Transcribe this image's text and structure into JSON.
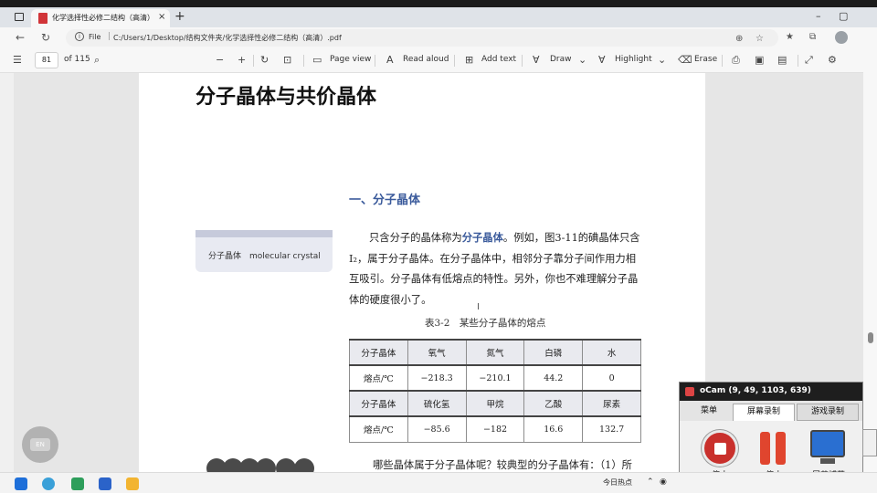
{
  "browser": {
    "tab_title": "化学选择性必修二结构（高清）",
    "tab_close": "×",
    "new_tab": "+",
    "min": "–",
    "restore": "▢",
    "address_prefix": "File",
    "address_sep": "|",
    "url": "C:/Users/1/Desktop/结构文件夹/化学选择性必修二结构（高清）.pdf"
  },
  "pdf_toolbar": {
    "page_current": "81",
    "page_total": "of 115",
    "zoom_out": "−",
    "zoom_in": "+",
    "page_view": "Page view",
    "read_aloud": "Read aloud",
    "add_text": "Add text",
    "draw": "Draw",
    "highlight": "Highlight",
    "erase": "Erase"
  },
  "document": {
    "title": "分子晶体与共价晶体",
    "section_heading": "一、分子晶体",
    "sidenote": "分子晶体　molecular crystal",
    "para_before": "只含分子的晶体称为",
    "para_term": "分子晶体",
    "para_after": "。例如，图3-11的碘晶体只含I₂，属于分子晶体。在分子晶体中，相邻分子靠分子间作用力相互吸引。分子晶体有低熔点的特性。另外，你也不难理解分子晶体的硬度很小了。",
    "table_caption": "表3-2　某些分子晶体的熔点",
    "table_rows": [
      [
        "分子晶体",
        "氧气",
        "氮气",
        "白磷",
        "水"
      ],
      [
        "熔点/℃",
        "−218.3",
        "−210.1",
        "44.2",
        "0"
      ],
      [
        "分子晶体",
        "硫化氢",
        "甲烷",
        "乙酸",
        "尿素"
      ],
      [
        "熔点/℃",
        "−85.6",
        "−182",
        "16.6",
        "132.7"
      ]
    ],
    "bottom_text": "哪些晶体属于分子晶体呢？较典型的分子晶体有：（1）所"
  },
  "floating": {
    "en_label": "EN"
  },
  "ocam": {
    "title": "oCam (9, 49, 1103, 639)",
    "tabs": [
      "菜单",
      "屏幕录制",
      "游戏录制"
    ],
    "tools": [
      "停止",
      "停止",
      "屏幕捕获"
    ]
  },
  "taskbar": {
    "weather": "今日热点"
  }
}
